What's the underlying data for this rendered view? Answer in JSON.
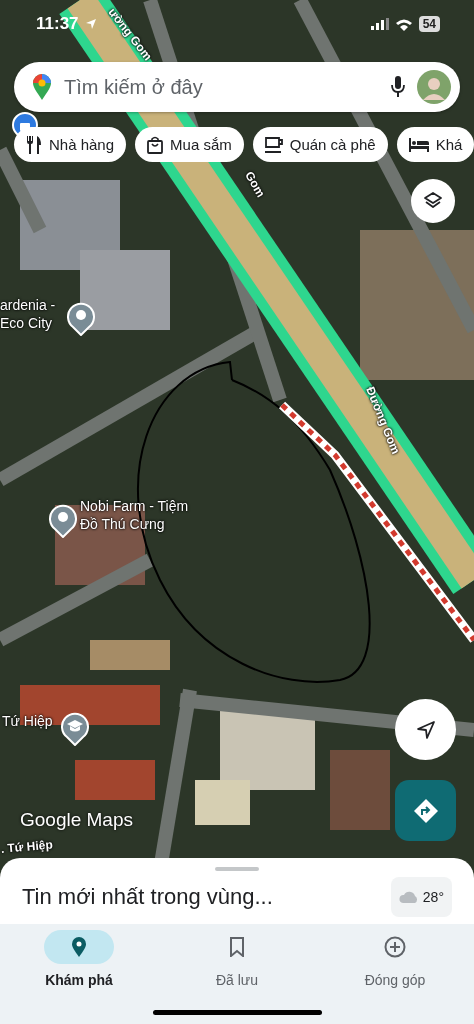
{
  "status_bar": {
    "time": "11:37",
    "battery": "54"
  },
  "search": {
    "placeholder": "Tìm kiếm ở đây"
  },
  "chips": [
    {
      "kind": "restaurant",
      "label": "Nhà hàng"
    },
    {
      "kind": "shopping",
      "label": "Mua sắm"
    },
    {
      "kind": "cafe",
      "label": "Quán cà phê"
    },
    {
      "kind": "hotel",
      "label": "Khá"
    }
  ],
  "map": {
    "labels": [
      {
        "kind": "road",
        "text": "ường Gom"
      },
      {
        "kind": "road",
        "text": "Gom"
      },
      {
        "kind": "place",
        "text": "ardenia -\nEco City"
      },
      {
        "kind": "road",
        "text": "Đường Gom"
      },
      {
        "kind": "place",
        "text": "Nobi Farm - Tiệm\nĐồ Thú Cưng"
      },
      {
        "kind": "school",
        "text": "Tứ Hiệp"
      },
      {
        "kind": "road",
        "text": ". Tứ Hiệp"
      }
    ],
    "logo": "Google Maps"
  },
  "sheet": {
    "title": "Tin mới nhất trong vùng...",
    "weather": "28°"
  },
  "nav": [
    {
      "kind": "explore",
      "label": "Khám phá",
      "selected": true
    },
    {
      "kind": "saved",
      "label": "Đã lưu",
      "selected": false
    },
    {
      "kind": "contribute",
      "label": "Đóng góp",
      "selected": false
    }
  ]
}
